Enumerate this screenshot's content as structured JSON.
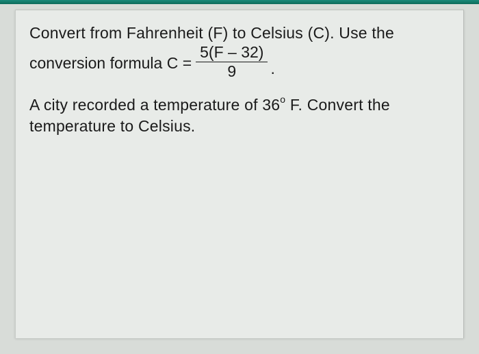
{
  "problem": {
    "intro_line": "Convert from Fahrenheit (F) to Celsius (C). Use the",
    "formula_prefix": "conversion formula C =",
    "formula_numerator": "5(F – 32)",
    "formula_denominator": "9",
    "formula_period": ".",
    "question_part1": "A city recorded a temperature of 36",
    "degree_symbol": "o",
    "question_part2": " F. Convert the temperature to Celsius."
  }
}
